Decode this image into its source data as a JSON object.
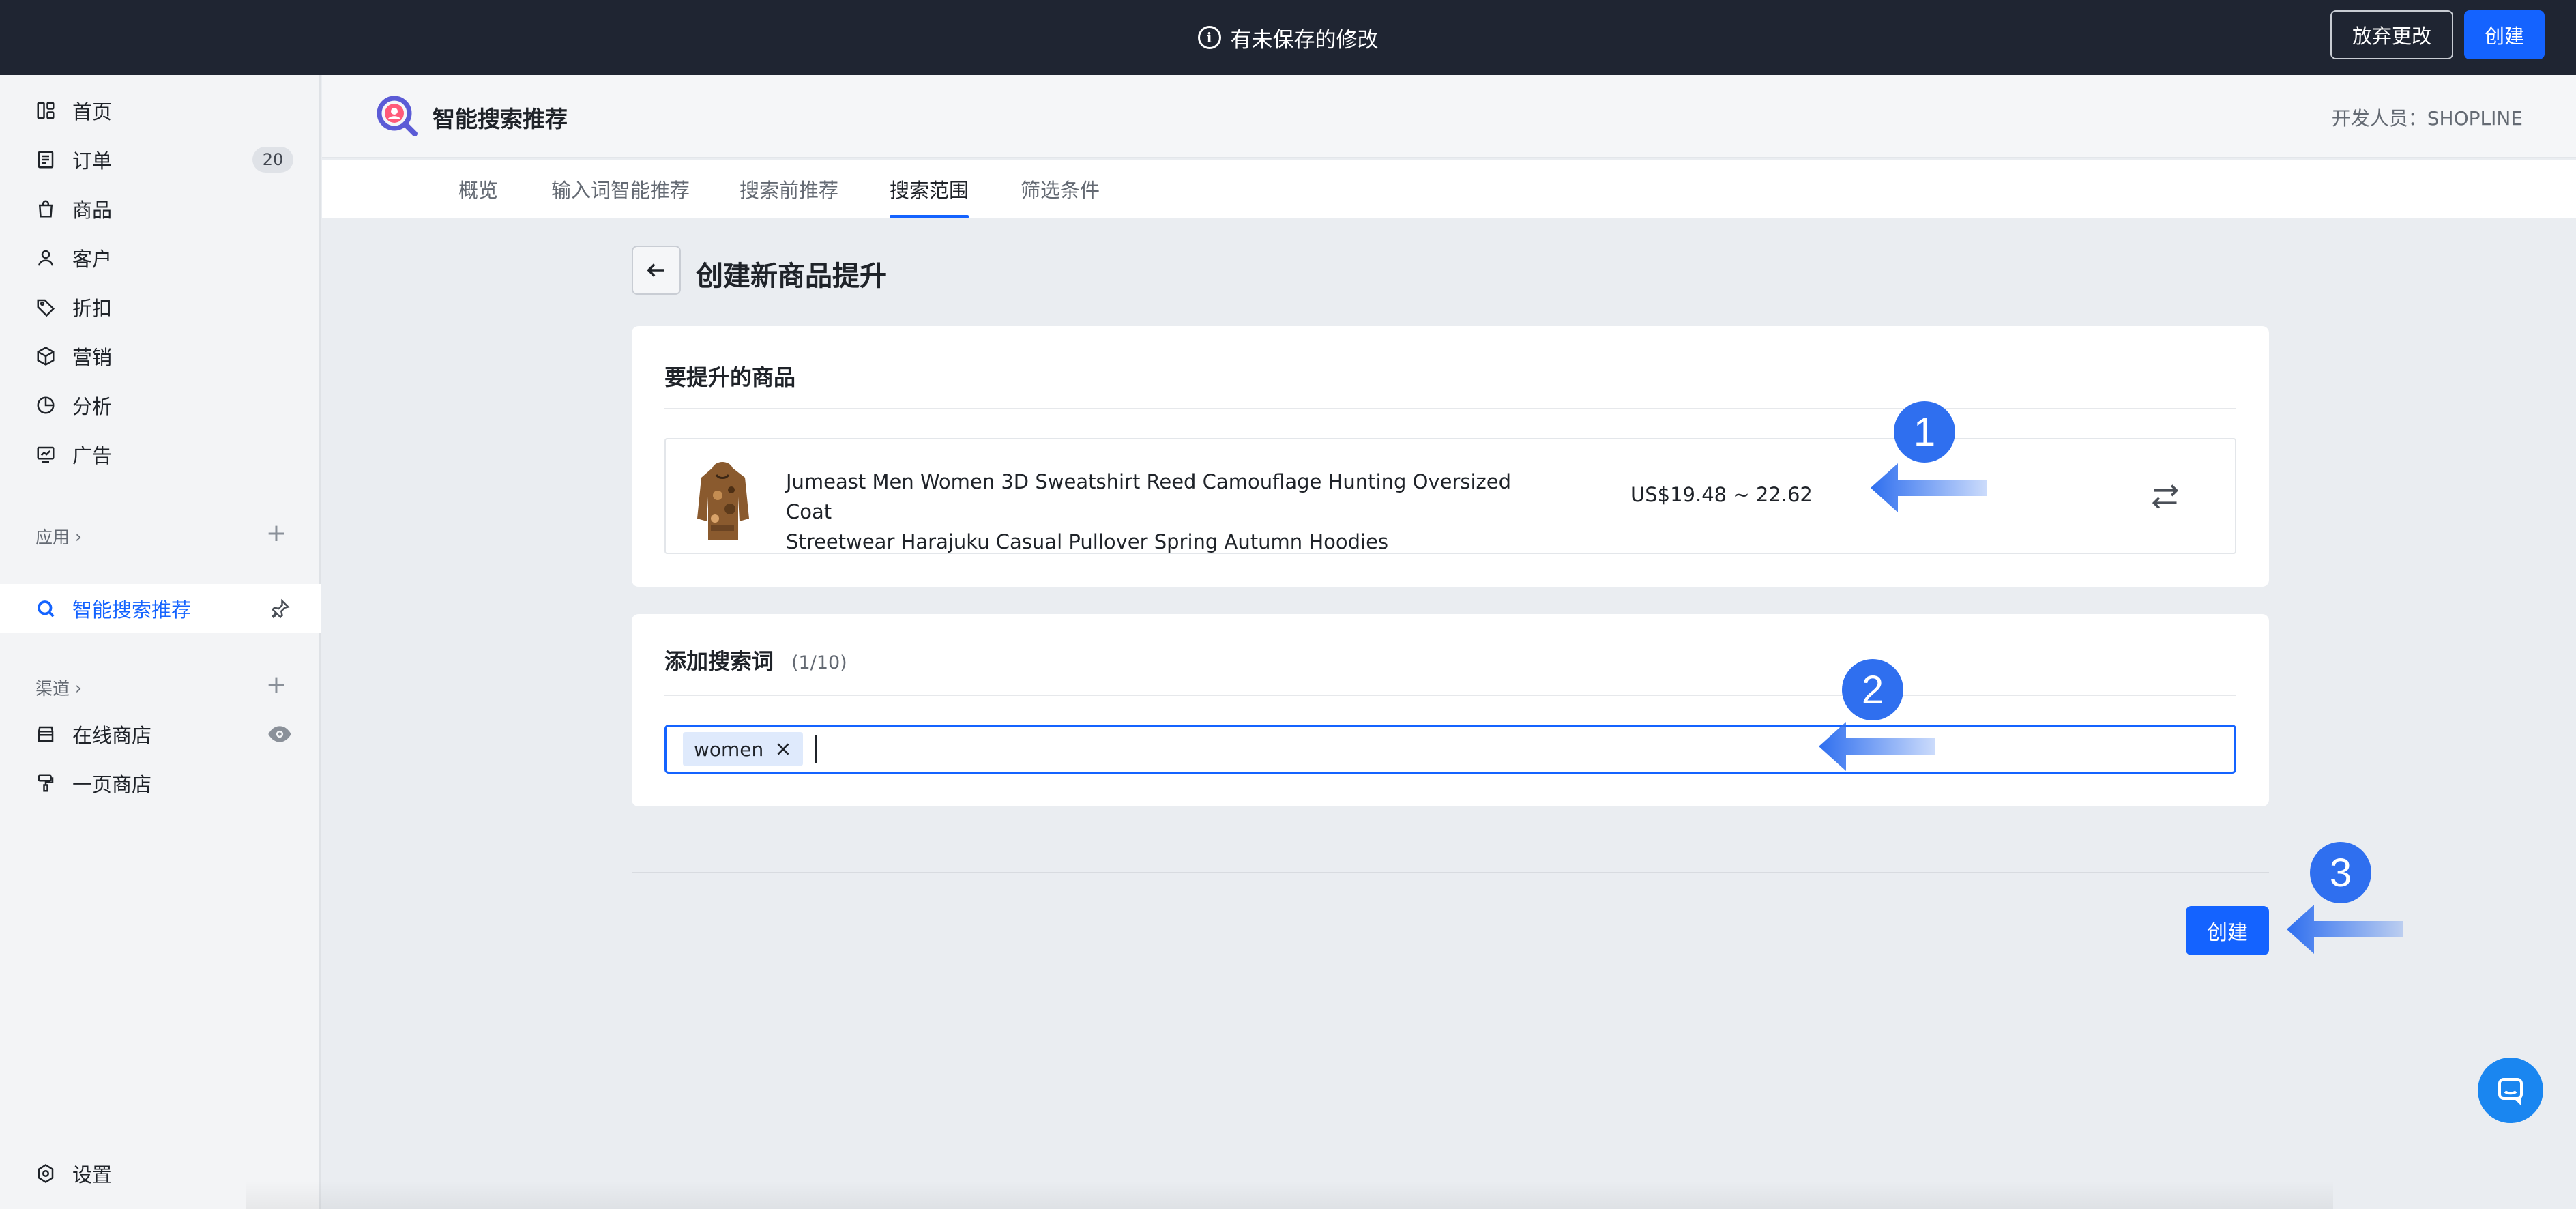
{
  "topbar": {
    "message": "有未保存的修改",
    "discard_label": "放弃更改",
    "create_label": "创建"
  },
  "sidebar": {
    "items": [
      {
        "label": "首页",
        "icon": "dashboard-icon"
      },
      {
        "label": "订单",
        "icon": "order-icon",
        "badge": "20"
      },
      {
        "label": "商品",
        "icon": "bag-icon"
      },
      {
        "label": "客户",
        "icon": "user-icon"
      },
      {
        "label": "折扣",
        "icon": "tag-icon"
      },
      {
        "label": "营销",
        "icon": "cube-icon"
      },
      {
        "label": "分析",
        "icon": "pie-chart-icon"
      },
      {
        "label": "广告",
        "icon": "ads-icon"
      }
    ],
    "apps_label": "应用",
    "active_app": "智能搜索推荐",
    "channels_label": "渠道",
    "channels": [
      {
        "label": "在线商店",
        "icon": "store-icon"
      },
      {
        "label": "一页商店",
        "icon": "paint-roller-icon"
      }
    ],
    "settings_label": "设置"
  },
  "header": {
    "app_title": "智能搜索推荐",
    "developer": "开发人员：SHOPLINE"
  },
  "tabs": [
    "概览",
    "输入词智能推荐",
    "搜索前推荐",
    "搜索范围",
    "筛选条件"
  ],
  "active_tab": "搜索范围",
  "page": {
    "title": "创建新商品提升"
  },
  "product_card": {
    "title": "要提升的商品",
    "product_name_line1": "Jumeast Men Women 3D Sweatshirt Reed Camouflage Hunting Oversized Coat",
    "product_name_line2": "Streetwear Harajuku Casual Pullover Spring Autumn Hoodies",
    "price": "US$19.48 ~ 22.62"
  },
  "keyword_card": {
    "title": "添加搜索词",
    "counter": "(1/10)",
    "tags": [
      "women"
    ]
  },
  "footer": {
    "create_label": "创建"
  },
  "markers": [
    "1",
    "2",
    "3"
  ],
  "colors": {
    "primary": "#1463ff",
    "topbar": "#1f2532",
    "marker": "#2f6fef"
  }
}
